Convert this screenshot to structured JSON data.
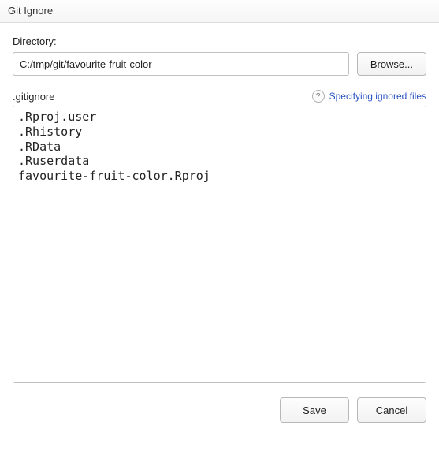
{
  "title": "Git Ignore",
  "directory": {
    "label": "Directory:",
    "value": "C:/tmp/git/favourite-fruit-color",
    "browse_label": "Browse..."
  },
  "gitignore": {
    "label": ".gitignore",
    "help_link": "Specifying ignored files",
    "content": ".Rproj.user\n.Rhistory\n.RData\n.Ruserdata\nfavourite-fruit-color.Rproj"
  },
  "footer": {
    "save_label": "Save",
    "cancel_label": "Cancel"
  }
}
